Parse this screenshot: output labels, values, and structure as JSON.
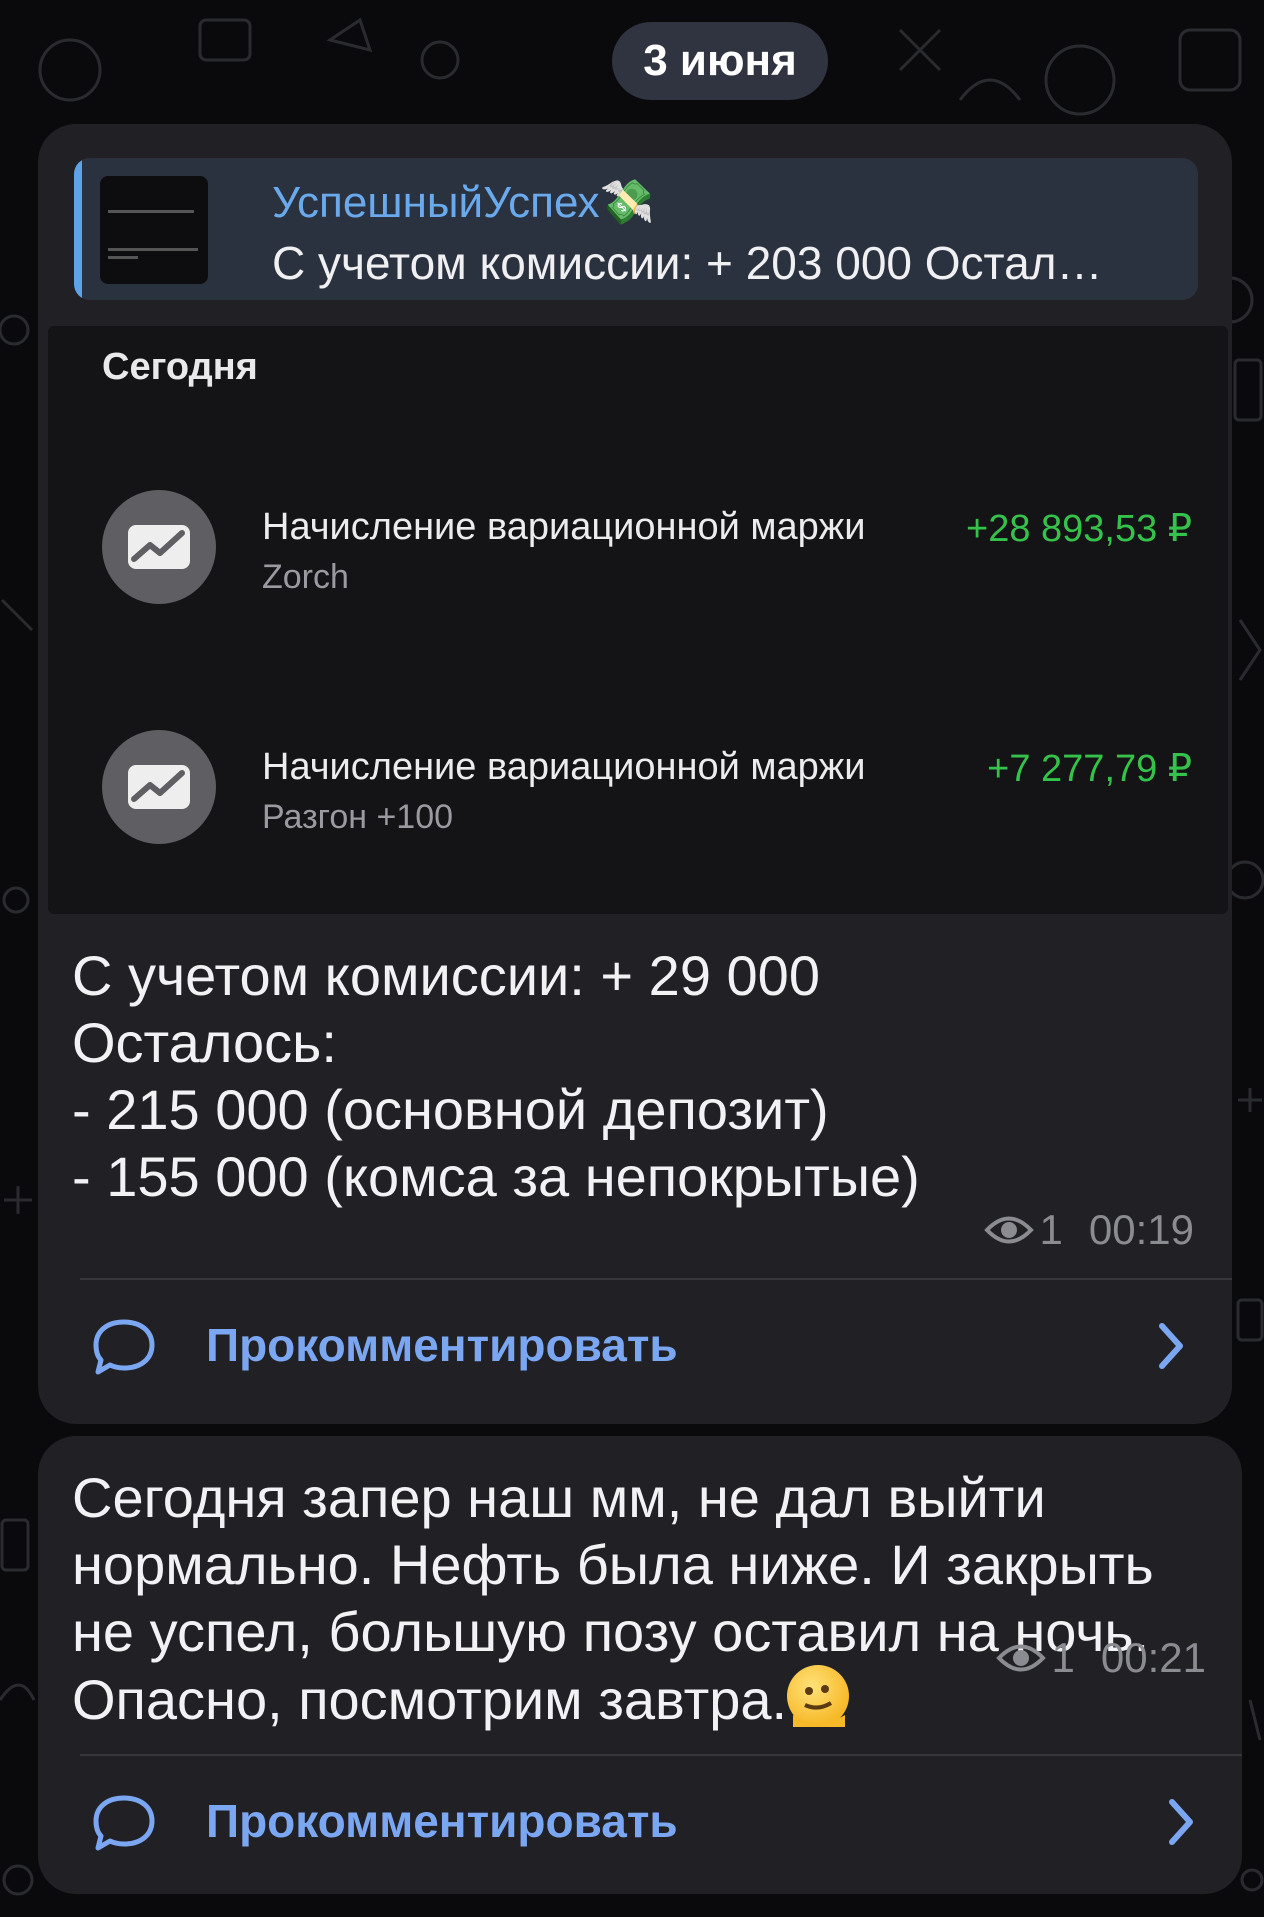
{
  "date_pill": "3 июня",
  "reply": {
    "channel_name": "УспешныйУспех",
    "channel_emoji": "💸",
    "preview_text": "С учетом комиссии: + 203 000 Остал…"
  },
  "screenshot": {
    "title": "Сегодня",
    "operations": [
      {
        "title": "Начисление вариационной маржи",
        "subtitle": "Zorch",
        "amount": "+28 893,53 ₽",
        "icon": "chart-up-icon"
      },
      {
        "title": "Начисление вариационной маржи",
        "subtitle": "Разгон +100",
        "amount": "+7 277,79 ₽",
        "icon": "chart-up-icon"
      }
    ]
  },
  "message1": {
    "text": "С учетом комиссии: + 29 000\nОсталось:\n- 215 000 (основной депозит)\n- 155 000 (комса за непокрытые)",
    "views": "1",
    "time": "00:19",
    "comment_label": "Прокомментировать"
  },
  "message2": {
    "text": "Сегодня запер наш мм, не дал выйти\nнормально. Нефть была ниже. И закрыть\nне успел, большую позу оставил на ночь.\nОпасно, посмотрим завтра.",
    "emoji": "🫠",
    "views": "1",
    "time": "00:21",
    "comment_label": "Прокомментировать"
  },
  "colors": {
    "bubble": "#212125",
    "accent_link": "#7ba6f2",
    "reply_name": "#6aa9ec",
    "positive_amount": "#35c24a"
  }
}
